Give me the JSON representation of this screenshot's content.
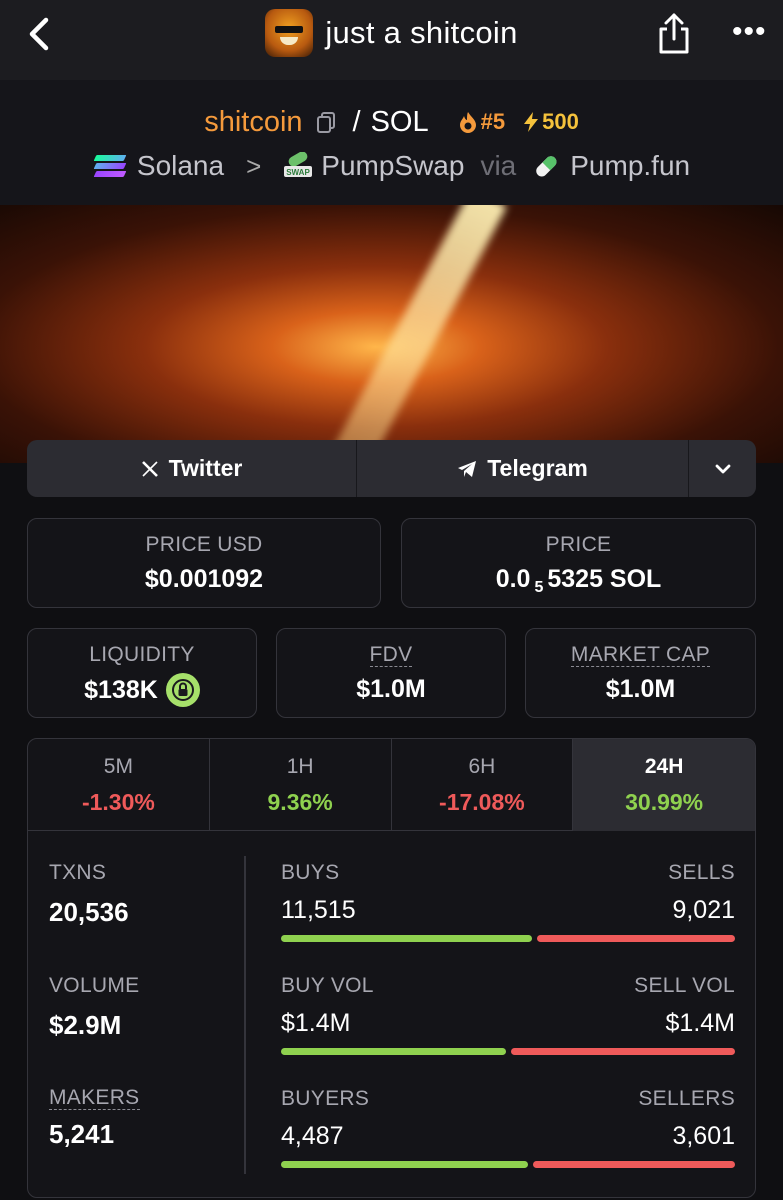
{
  "nav": {
    "title": "just a shitcoin",
    "more": "•••"
  },
  "pair": {
    "base": "shitcoin",
    "slash": "/",
    "quote": "SOL",
    "rank": "#5",
    "boost": "500",
    "chain": "Solana",
    "dex": "PumpSwap",
    "via": "via",
    "launchpad": "Pump.fun",
    "chevron": ">"
  },
  "socials": {
    "twitter": "Twitter",
    "telegram": "Telegram"
  },
  "price": {
    "usd_label": "PRICE USD",
    "usd_value": "$0.001092",
    "native_label": "PRICE",
    "native_prefix": "0.0",
    "native_zeros": "5",
    "native_digits": "5325 SOL"
  },
  "market": {
    "liquidity_label": "LIQUIDITY",
    "liquidity_value": "$138K",
    "fdv_label": "FDV",
    "fdv_value": "$1.0M",
    "mcap_label": "MARKET CAP",
    "mcap_value": "$1.0M"
  },
  "timeframes": [
    {
      "label": "5M",
      "change": "-1.30%",
      "direction": "down"
    },
    {
      "label": "1H",
      "change": "9.36%",
      "direction": "up"
    },
    {
      "label": "6H",
      "change": "-17.08%",
      "direction": "down"
    },
    {
      "label": "24H",
      "change": "30.99%",
      "direction": "up",
      "active": true
    }
  ],
  "stats": {
    "txns_label": "TXNS",
    "txns_value": "20,536",
    "volume_label": "VOLUME",
    "volume_value": "$2.9M",
    "makers_label": "MAKERS",
    "makers_value": "5,241",
    "buys_label": "BUYS",
    "buys_value": "11,515",
    "sells_label": "SELLS",
    "sells_value": "9,021",
    "buys_share": 0.56,
    "buy_vol_label": "BUY VOL",
    "buy_vol_value": "$1.4M",
    "sell_vol_label": "SELL VOL",
    "sell_vol_value": "$1.4M",
    "buy_vol_share": 0.5,
    "buyers_label": "BUYERS",
    "buyers_value": "4,487",
    "sellers_label": "SELLERS",
    "sellers_value": "3,601",
    "buyers_share": 0.55
  },
  "colors": {
    "accent": "#f59a3c",
    "positive": "#8fd14f",
    "negative": "#ef5a5a"
  }
}
